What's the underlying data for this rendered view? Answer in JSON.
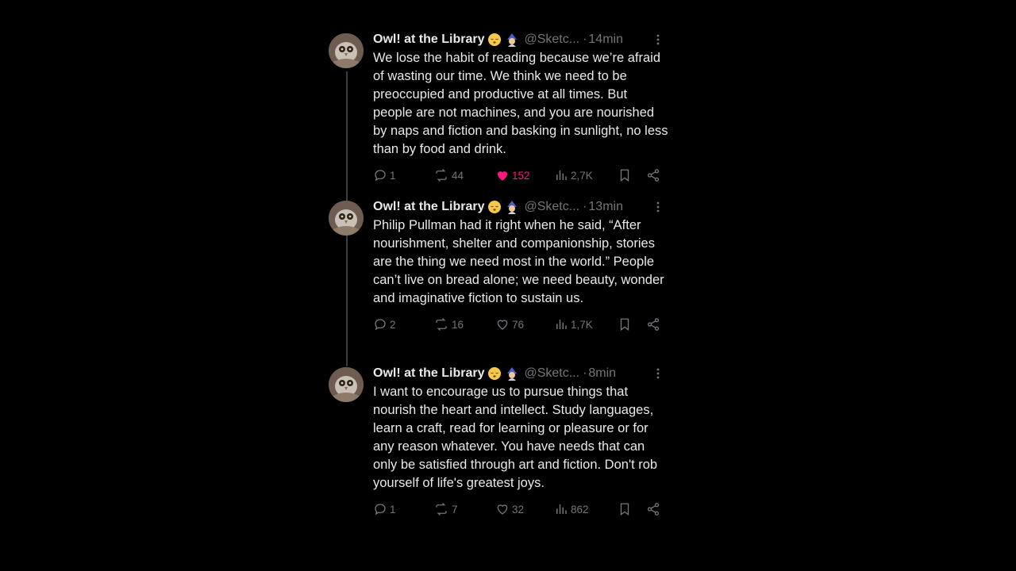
{
  "tweets": [
    {
      "name": "Owl! at the Library",
      "handle": "@Sketc...",
      "time": "14min",
      "text": "We lose the habit of reading because we’re afraid of wasting our time. We think we need to be preoccupied and productive at all times. But people are not machines, and you are nourished by naps and fiction and basking in sunlight, no less than by food and drink.",
      "replies": "1",
      "retweets": "44",
      "likes": "152",
      "liked": true,
      "views": "2,7K"
    },
    {
      "name": "Owl! at the Library",
      "handle": "@Sketc...",
      "time": "13min",
      "text": "Philip Pullman had it right when he said, “After nourishment, shelter and companionship, stories are the thing we need most in the world.” People can’t live on bread alone; we need beauty, wonder and imaginative fiction to sustain us.",
      "replies": "2",
      "retweets": "16",
      "likes": "76",
      "liked": false,
      "views": "1,7K"
    },
    {
      "name": "Owl! at the Library",
      "handle": "@Sketc...",
      "time": "8min",
      "text": "I want to encourage us to pursue things that nourish the heart and intellect. Study languages, learn a craft, read for learning or pleasure or for any reason whatever. You have needs that can only be satisfied through art and fiction. Don't rob yourself of life's greatest joys.",
      "replies": "1",
      "retweets": "7",
      "likes": "32",
      "liked": false,
      "views": "862"
    }
  ],
  "icons": {
    "name_emojis": [
      "sleeping-face-emoji",
      "mage-emoji"
    ],
    "actions": [
      "reply-icon",
      "retweet-icon",
      "like-icon",
      "views-icon",
      "bookmark-icon",
      "share-icon"
    ]
  },
  "colors": {
    "background": "#000000",
    "text": "#e7e9ea",
    "muted": "#71767b",
    "like_active": "#f91880",
    "thread_line": "#3a3d41"
  }
}
